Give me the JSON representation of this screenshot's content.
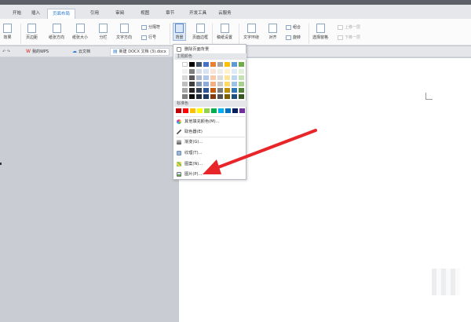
{
  "menu": {
    "tabs": [
      "开始",
      "插入",
      "页面布局",
      "引用",
      "审阅",
      "视图",
      "章节",
      "开发工具",
      "云服务"
    ],
    "active_index": 2
  },
  "ribbon": {
    "theme": "效果",
    "margins": "页边距",
    "orientation": "纸张方向",
    "size": "纸张大小",
    "columns": "分栏",
    "text_direction": "文字方向",
    "line_numbers": "行号",
    "breaks": "分隔符",
    "background": "背景",
    "page_border": "页面边框",
    "draft_settings": "稿纸设置",
    "text_wrap": "文字环绕",
    "align": "对齐",
    "rotate": "旋转",
    "group": "组合",
    "selection_pane": "选择窗格",
    "bring_forward": "上移一层",
    "send_backward": "下移一层"
  },
  "doctabs": [
    "我的WPS",
    "云文档",
    "新建 DOCX 文档 (3).docx"
  ],
  "dropdown": {
    "remove_bg": "删除页面背景",
    "theme_colors_label": "主题颜色",
    "standard_colors_label": "标准色",
    "more_colors": "其他填充颜色(M)...",
    "eyedropper": "取色器(E)",
    "gradient": "渐变(G)...",
    "texture": "纹理(T)...",
    "pattern": "图案(N)...",
    "picture": "图片(P)...",
    "theme_row1": [
      "#ffffff",
      "#000000",
      "#44546a",
      "#4472c4",
      "#ed7d31",
      "#a5a5a5",
      "#ffc000",
      "#5b9bd5",
      "#70ad47"
    ],
    "theme_shade_cols": [
      [
        "#f2f2f2",
        "#d9d9d9",
        "#bfbfbf",
        "#a6a6a6",
        "#808080"
      ],
      [
        "#7f7f7f",
        "#595959",
        "#404040",
        "#262626",
        "#0d0d0d"
      ],
      [
        "#d6dce4",
        "#adb9ca",
        "#8497b0",
        "#333f4f",
        "#222a35"
      ],
      [
        "#d9e2f3",
        "#b4c6e7",
        "#8eaadb",
        "#2f5496",
        "#1f3864"
      ],
      [
        "#fbe4d5",
        "#f7caac",
        "#f4b083",
        "#c55a11",
        "#833c0b"
      ],
      [
        "#ededed",
        "#dbdbdb",
        "#c9c9c9",
        "#7b7b7b",
        "#525252"
      ],
      [
        "#fff2cc",
        "#fee599",
        "#ffd965",
        "#bf8f00",
        "#7f6000"
      ],
      [
        "#deebf6",
        "#bdd7ee",
        "#9cc3e5",
        "#2e75b5",
        "#1e4e79"
      ],
      [
        "#e2efd9",
        "#c5e0b3",
        "#a8d08d",
        "#538135",
        "#375623"
      ]
    ],
    "standard": [
      "#c00000",
      "#ff0000",
      "#ffc000",
      "#ffff00",
      "#92d050",
      "#00b050",
      "#00b0f0",
      "#0070c0",
      "#002060",
      "#7030a0"
    ]
  },
  "colors": {
    "annotation_arrow": "#e8262a",
    "ribbon_accent": "#2e7bd0"
  }
}
